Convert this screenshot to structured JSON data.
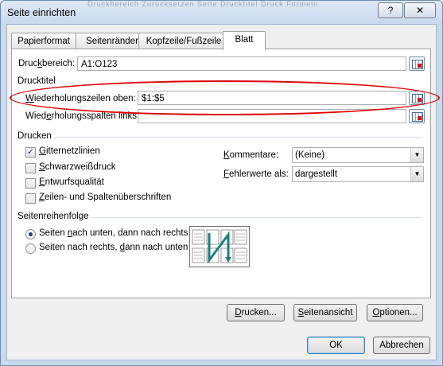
{
  "window": {
    "title": "Seite einrichten",
    "help_label": "?",
    "close_label": "✕",
    "ghost_text": "Druckbereich   Zurücksetzen   Seite   Drucktitel   Druck   Formeln"
  },
  "tabs": [
    "Papierformat",
    "Seitenränder",
    "Kopfzeile/Fußzeile",
    "Blatt"
  ],
  "active_tab": "Blatt",
  "print_area": {
    "label_pre": "Druc",
    "label_u": "k",
    "label_post": "bereich:",
    "value": "A1:O123"
  },
  "print_titles": {
    "heading": "Drucktitel",
    "rows": {
      "label_u": "W",
      "label_post": "iederholungszeilen oben:",
      "value": "$1:$5"
    },
    "cols": {
      "label_pre": "Wied",
      "label_u": "e",
      "label_post": "rholungsspalten links:",
      "value": ""
    }
  },
  "print": {
    "heading": "Drucken",
    "options": [
      {
        "pre": "",
        "u": "G",
        "post": "itternetzlinien",
        "checked": true
      },
      {
        "pre": "",
        "u": "S",
        "post": "chwarzweißdruck",
        "checked": false
      },
      {
        "pre": "",
        "u": "E",
        "post": "ntwurfsqualität",
        "checked": false
      },
      {
        "pre": "",
        "u": "Z",
        "post": "eilen- und Spaltenüberschriften",
        "checked": false
      }
    ],
    "comments": {
      "label_u": "K",
      "label_post": "ommentare:",
      "value": "(Keine)"
    },
    "errors": {
      "label_u": "F",
      "label_post": "ehlerwerte als:",
      "value": "dargestellt"
    }
  },
  "page_order": {
    "heading": "Seitenreihenfolge",
    "options": [
      {
        "pre": "Seiten ",
        "u": "n",
        "post": "ach unten, dann nach rechts",
        "selected": true
      },
      {
        "pre": "Seiten nach rechts, ",
        "u": "d",
        "post": "ann nach unten",
        "selected": false
      }
    ]
  },
  "buttons": {
    "print": {
      "u": "D",
      "post": "rucken..."
    },
    "preview": {
      "u": "S",
      "post": "eitenansicht"
    },
    "options": {
      "u": "O",
      "post": "ptionen..."
    },
    "ok": "OK",
    "cancel": "Abbrechen"
  },
  "colors": {
    "highlight_ellipse": "#e00000"
  }
}
